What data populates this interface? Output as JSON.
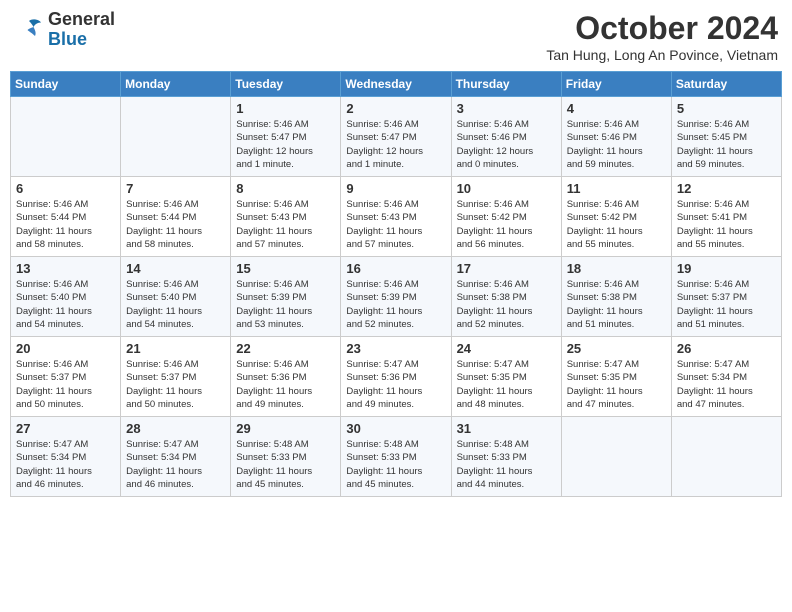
{
  "logo": {
    "text_general": "General",
    "text_blue": "Blue"
  },
  "header": {
    "month_year": "October 2024",
    "location": "Tan Hung, Long An Povince, Vietnam"
  },
  "days_of_week": [
    "Sunday",
    "Monday",
    "Tuesday",
    "Wednesday",
    "Thursday",
    "Friday",
    "Saturday"
  ],
  "weeks": [
    [
      {
        "day": "",
        "info": ""
      },
      {
        "day": "",
        "info": ""
      },
      {
        "day": "1",
        "info": "Sunrise: 5:46 AM\nSunset: 5:47 PM\nDaylight: 12 hours\nand 1 minute."
      },
      {
        "day": "2",
        "info": "Sunrise: 5:46 AM\nSunset: 5:47 PM\nDaylight: 12 hours\nand 1 minute."
      },
      {
        "day": "3",
        "info": "Sunrise: 5:46 AM\nSunset: 5:46 PM\nDaylight: 12 hours\nand 0 minutes."
      },
      {
        "day": "4",
        "info": "Sunrise: 5:46 AM\nSunset: 5:46 PM\nDaylight: 11 hours\nand 59 minutes."
      },
      {
        "day": "5",
        "info": "Sunrise: 5:46 AM\nSunset: 5:45 PM\nDaylight: 11 hours\nand 59 minutes."
      }
    ],
    [
      {
        "day": "6",
        "info": "Sunrise: 5:46 AM\nSunset: 5:44 PM\nDaylight: 11 hours\nand 58 minutes."
      },
      {
        "day": "7",
        "info": "Sunrise: 5:46 AM\nSunset: 5:44 PM\nDaylight: 11 hours\nand 58 minutes."
      },
      {
        "day": "8",
        "info": "Sunrise: 5:46 AM\nSunset: 5:43 PM\nDaylight: 11 hours\nand 57 minutes."
      },
      {
        "day": "9",
        "info": "Sunrise: 5:46 AM\nSunset: 5:43 PM\nDaylight: 11 hours\nand 57 minutes."
      },
      {
        "day": "10",
        "info": "Sunrise: 5:46 AM\nSunset: 5:42 PM\nDaylight: 11 hours\nand 56 minutes."
      },
      {
        "day": "11",
        "info": "Sunrise: 5:46 AM\nSunset: 5:42 PM\nDaylight: 11 hours\nand 55 minutes."
      },
      {
        "day": "12",
        "info": "Sunrise: 5:46 AM\nSunset: 5:41 PM\nDaylight: 11 hours\nand 55 minutes."
      }
    ],
    [
      {
        "day": "13",
        "info": "Sunrise: 5:46 AM\nSunset: 5:40 PM\nDaylight: 11 hours\nand 54 minutes."
      },
      {
        "day": "14",
        "info": "Sunrise: 5:46 AM\nSunset: 5:40 PM\nDaylight: 11 hours\nand 54 minutes."
      },
      {
        "day": "15",
        "info": "Sunrise: 5:46 AM\nSunset: 5:39 PM\nDaylight: 11 hours\nand 53 minutes."
      },
      {
        "day": "16",
        "info": "Sunrise: 5:46 AM\nSunset: 5:39 PM\nDaylight: 11 hours\nand 52 minutes."
      },
      {
        "day": "17",
        "info": "Sunrise: 5:46 AM\nSunset: 5:38 PM\nDaylight: 11 hours\nand 52 minutes."
      },
      {
        "day": "18",
        "info": "Sunrise: 5:46 AM\nSunset: 5:38 PM\nDaylight: 11 hours\nand 51 minutes."
      },
      {
        "day": "19",
        "info": "Sunrise: 5:46 AM\nSunset: 5:37 PM\nDaylight: 11 hours\nand 51 minutes."
      }
    ],
    [
      {
        "day": "20",
        "info": "Sunrise: 5:46 AM\nSunset: 5:37 PM\nDaylight: 11 hours\nand 50 minutes."
      },
      {
        "day": "21",
        "info": "Sunrise: 5:46 AM\nSunset: 5:37 PM\nDaylight: 11 hours\nand 50 minutes."
      },
      {
        "day": "22",
        "info": "Sunrise: 5:46 AM\nSunset: 5:36 PM\nDaylight: 11 hours\nand 49 minutes."
      },
      {
        "day": "23",
        "info": "Sunrise: 5:47 AM\nSunset: 5:36 PM\nDaylight: 11 hours\nand 49 minutes."
      },
      {
        "day": "24",
        "info": "Sunrise: 5:47 AM\nSunset: 5:35 PM\nDaylight: 11 hours\nand 48 minutes."
      },
      {
        "day": "25",
        "info": "Sunrise: 5:47 AM\nSunset: 5:35 PM\nDaylight: 11 hours\nand 47 minutes."
      },
      {
        "day": "26",
        "info": "Sunrise: 5:47 AM\nSunset: 5:34 PM\nDaylight: 11 hours\nand 47 minutes."
      }
    ],
    [
      {
        "day": "27",
        "info": "Sunrise: 5:47 AM\nSunset: 5:34 PM\nDaylight: 11 hours\nand 46 minutes."
      },
      {
        "day": "28",
        "info": "Sunrise: 5:47 AM\nSunset: 5:34 PM\nDaylight: 11 hours\nand 46 minutes."
      },
      {
        "day": "29",
        "info": "Sunrise: 5:48 AM\nSunset: 5:33 PM\nDaylight: 11 hours\nand 45 minutes."
      },
      {
        "day": "30",
        "info": "Sunrise: 5:48 AM\nSunset: 5:33 PM\nDaylight: 11 hours\nand 45 minutes."
      },
      {
        "day": "31",
        "info": "Sunrise: 5:48 AM\nSunset: 5:33 PM\nDaylight: 11 hours\nand 44 minutes."
      },
      {
        "day": "",
        "info": ""
      },
      {
        "day": "",
        "info": ""
      }
    ]
  ]
}
